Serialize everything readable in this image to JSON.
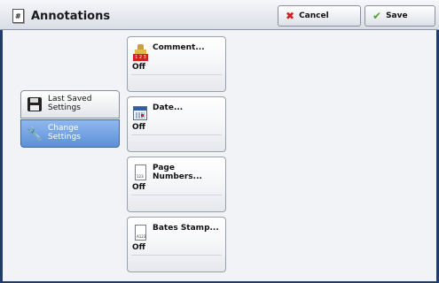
{
  "window": {
    "title": "Annotations",
    "title_icon_glyph": "#"
  },
  "toolbar": {
    "cancel_label": "Cancel",
    "save_label": "Save"
  },
  "side_menu": {
    "last_saved": {
      "line1": "Last Saved",
      "line2": "Settings"
    },
    "change": {
      "line1": "Change",
      "line2": "Settings",
      "selected": true
    }
  },
  "features": [
    {
      "title": "Comment...",
      "value": "Off",
      "icon": "comment-stamp-icon",
      "icon_text": "1 2 3"
    },
    {
      "title": "Date...",
      "value": "Off",
      "icon": "calendar-icon"
    },
    {
      "title": "Page Numbers...",
      "value": "Off",
      "icon": "page-number-icon",
      "icon_text": "123"
    },
    {
      "title": "Bates Stamp...",
      "value": "Off",
      "icon": "bates-stamp-icon",
      "icon_text": "A123"
    }
  ],
  "colors": {
    "selected": "#5d8fd8",
    "frame": "#1f3c6a",
    "cancel_icon": "#d21f1f",
    "save_icon": "#4fa52b"
  }
}
